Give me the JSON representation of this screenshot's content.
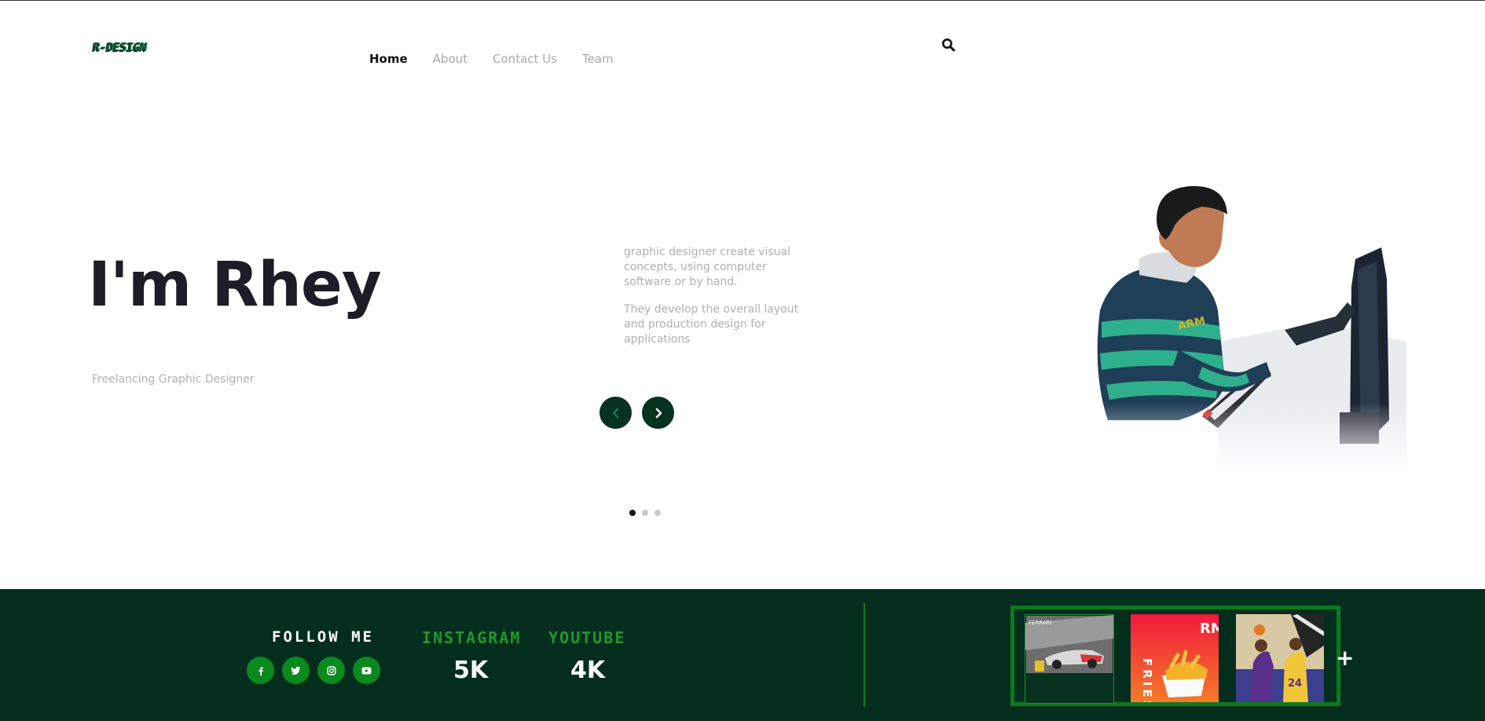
{
  "header": {
    "logo_text": "R-DESIGN",
    "nav": [
      {
        "label": "Home",
        "active": true
      },
      {
        "label": "About",
        "active": false
      },
      {
        "label": "Contact Us",
        "active": false
      },
      {
        "label": "Team",
        "active": false
      }
    ],
    "search_icon": "search-icon"
  },
  "hero": {
    "title": "I'm Rhey",
    "subtitle": "Freelancing Graphic Designer",
    "description": [
      "graphic designer create visual concepts, using computer software or by hand.",
      "They develop the overall layout and production design for applications"
    ],
    "prev_icon": "chevron-left-icon",
    "next_icon": "chevron-right-icon",
    "slides": {
      "count": 3,
      "active": 1
    },
    "image": "illustration of designer at computer"
  },
  "footer": {
    "follow_label": "FOLLOW ME",
    "social": [
      "facebook-icon",
      "twitter-icon",
      "instagram-icon",
      "youtube-icon"
    ],
    "stats": [
      {
        "label": "INSTAGRAM",
        "value": "5K"
      },
      {
        "label": "YOUTUBE",
        "value": "4K"
      }
    ],
    "gallery": {
      "items": [
        {
          "caption": "FERRARI"
        },
        {
          "caption": "FRIES",
          "brand": "RM"
        },
        {
          "caption": "24"
        }
      ],
      "more_label": "+"
    }
  },
  "colors": {
    "footer_bg": "#032e1d",
    "accent_green": "#0a8a1e",
    "stat_label": "#1c9a2e",
    "arrow_bg": "#06321f"
  }
}
